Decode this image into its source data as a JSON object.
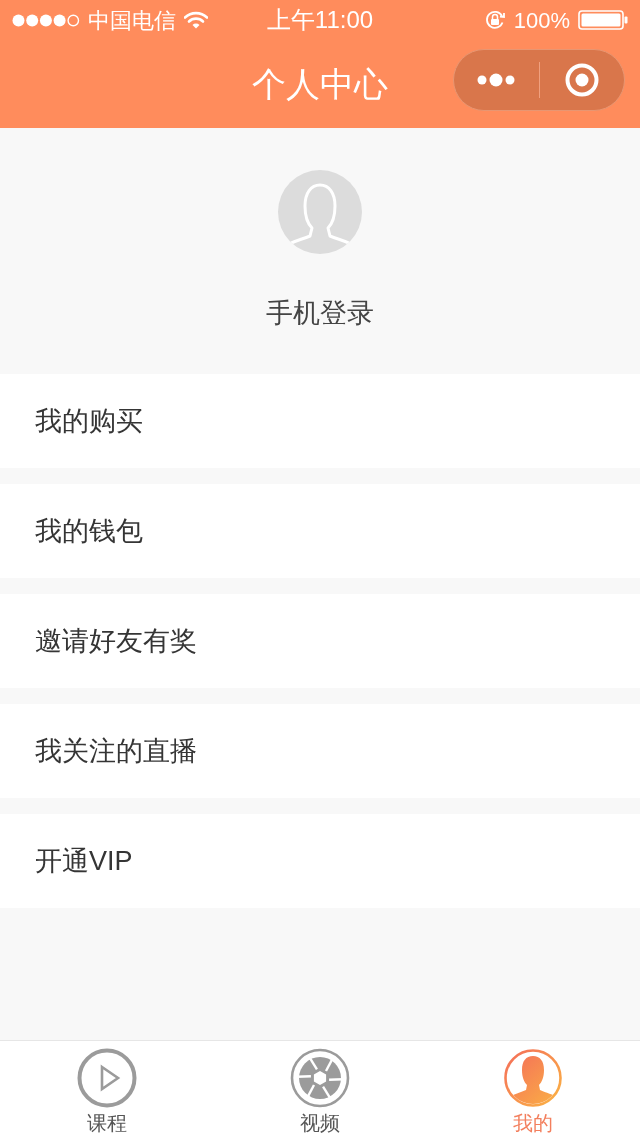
{
  "status_bar": {
    "carrier": "中国电信",
    "time": "上午11:00",
    "battery": "100%"
  },
  "nav": {
    "title": "个人中心"
  },
  "profile": {
    "login_label": "手机登录"
  },
  "menu": [
    {
      "label": "我的购买"
    },
    {
      "label": "我的钱包"
    },
    {
      "label": "邀请好友有奖"
    },
    {
      "label": "我关注的直播"
    },
    {
      "label": "开通VIP"
    }
  ],
  "tab_bar": [
    {
      "label": "课程",
      "kind": "play",
      "selected": false
    },
    {
      "label": "视频",
      "kind": "aperture",
      "selected": false
    },
    {
      "label": "我的",
      "kind": "person",
      "selected": true
    }
  ]
}
